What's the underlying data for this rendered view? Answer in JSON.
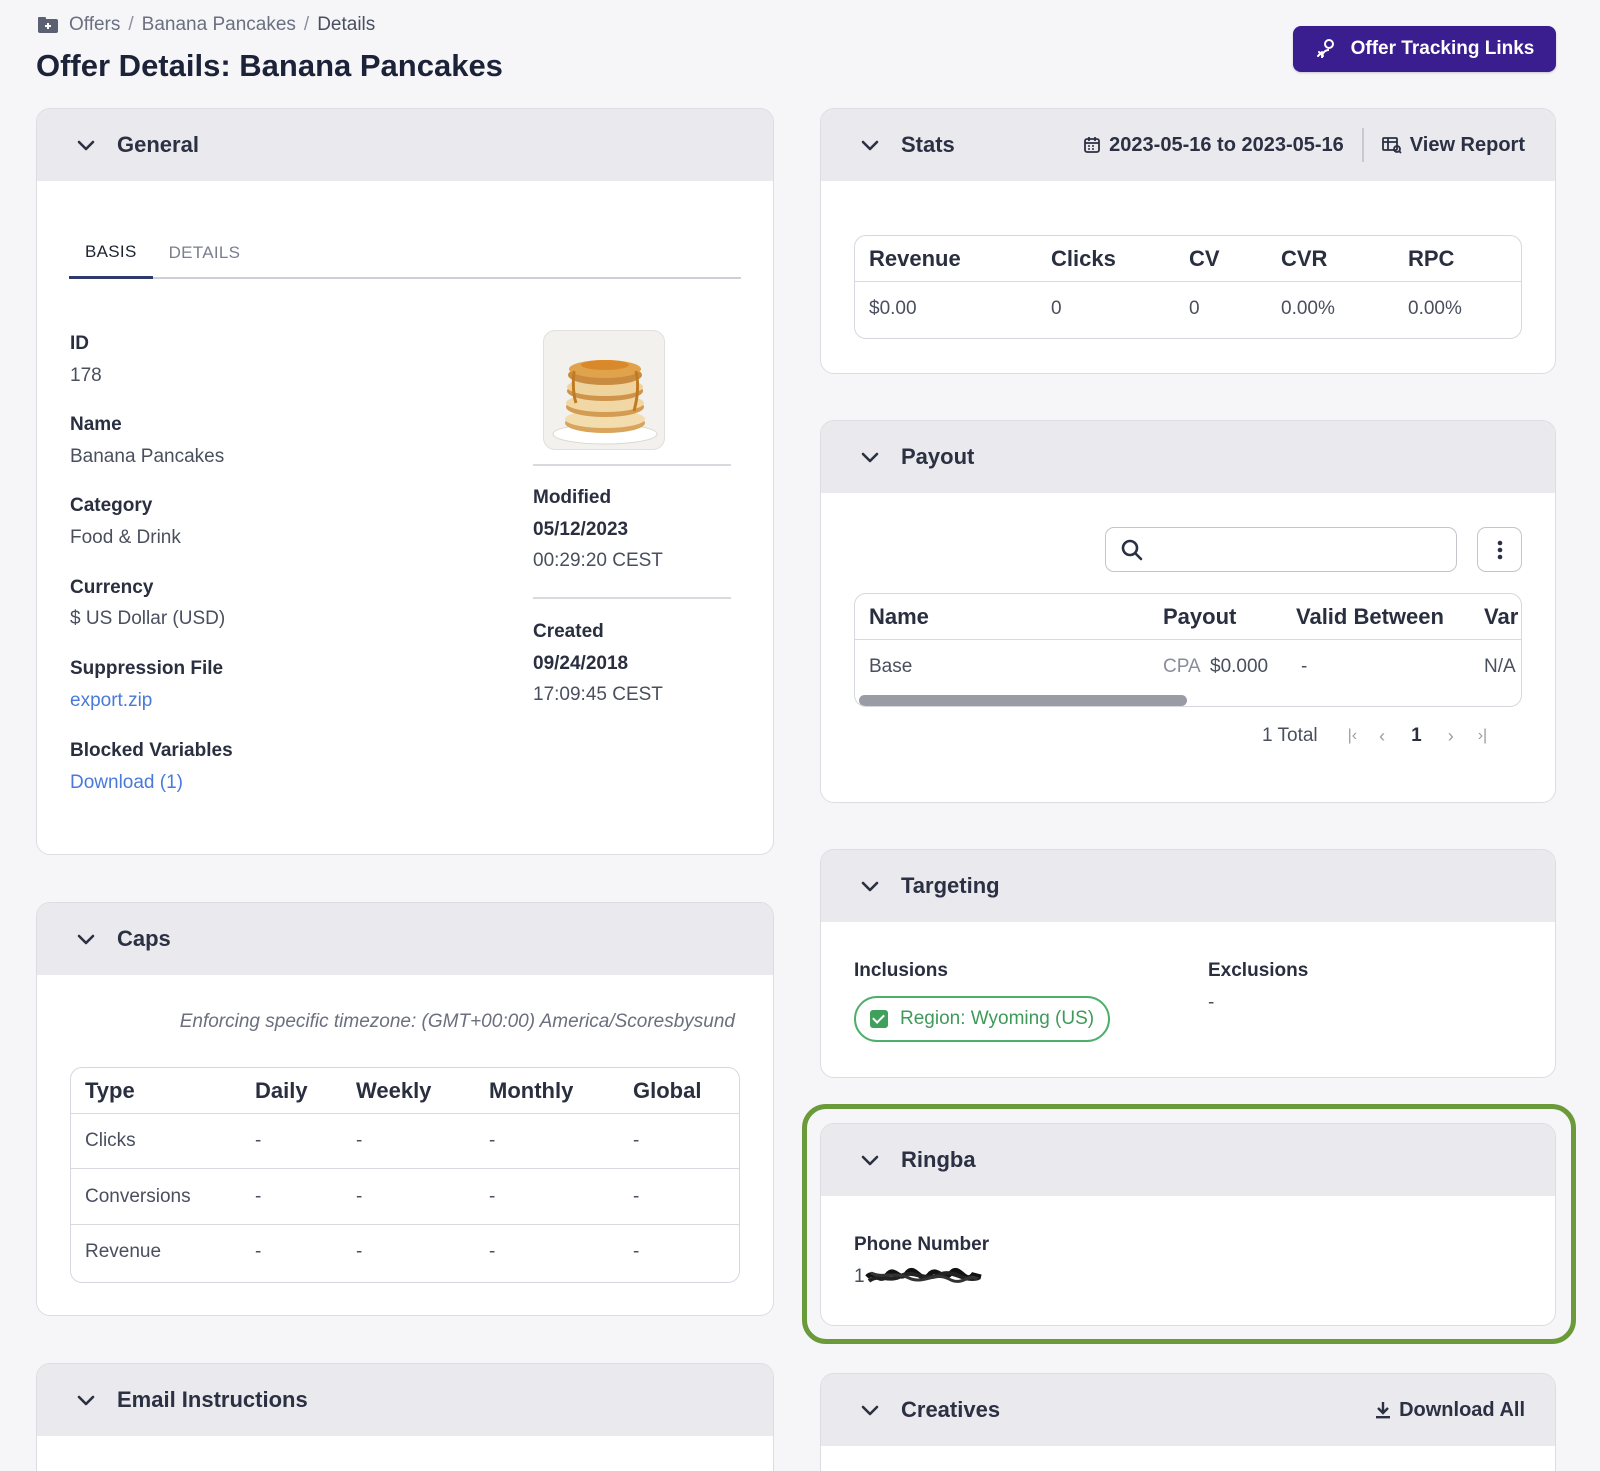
{
  "breadcrumb": {
    "root": "Offers",
    "middle": "Banana Pancakes",
    "current": "Details",
    "separator": "/"
  },
  "page_title": "Offer Details: Banana Pancakes",
  "header_button": {
    "label": "Offer Tracking Links"
  },
  "general": {
    "title": "General",
    "tabs": [
      {
        "label": "BASIS"
      },
      {
        "label": "DETAILS"
      }
    ],
    "fields": {
      "id_label": "ID",
      "id_value": "178",
      "name_label": "Name",
      "name_value": "Banana Pancakes",
      "category_label": "Category",
      "category_value": "Food & Drink",
      "currency_label": "Currency",
      "currency_value": "$ US Dollar (USD)",
      "suppression_label": "Suppression File",
      "suppression_value": "export.zip",
      "blocked_label": "Blocked Variables",
      "blocked_value": "Download (1)",
      "modified_label": "Modified",
      "modified_date": "05/12/2023",
      "modified_time": "00:29:20 CEST",
      "created_label": "Created",
      "created_date": "09/24/2018",
      "created_time": "17:09:45 CEST"
    }
  },
  "caps": {
    "title": "Caps",
    "timezone_note": "Enforcing specific timezone: (GMT+00:00) America/Scoresbysund",
    "headers": [
      "Type",
      "Daily",
      "Weekly",
      "Monthly",
      "Global"
    ],
    "rows": [
      [
        "Clicks",
        "-",
        "-",
        "-",
        "-"
      ],
      [
        "Conversions",
        "-",
        "-",
        "-",
        "-"
      ],
      [
        "Revenue",
        "-",
        "-",
        "-",
        "-"
      ]
    ]
  },
  "email_instructions": {
    "title": "Email Instructions"
  },
  "stats": {
    "title": "Stats",
    "date_range": "2023-05-16 to 2023-05-16",
    "view_report": "View Report",
    "headers": [
      "Revenue",
      "Clicks",
      "CV",
      "CVR",
      "RPC"
    ],
    "values": [
      "$0.00",
      "0",
      "0",
      "0.00%",
      "0.00%"
    ]
  },
  "payout": {
    "title": "Payout",
    "search_placeholder": "",
    "headers": [
      "Name",
      "Payout",
      "Valid Between",
      "Var"
    ],
    "row": {
      "name": "Base",
      "type": "CPA",
      "amount": "$0.000",
      "valid": "-",
      "var": "N/A"
    },
    "total": "1 Total",
    "page": "1"
  },
  "targeting": {
    "title": "Targeting",
    "inclusions_label": "Inclusions",
    "inclusion_pill": "Region: Wyoming (US)",
    "exclusions_label": "Exclusions",
    "exclusions_value": "-"
  },
  "ringba": {
    "title": "Ringba",
    "phone_label": "Phone Number",
    "phone_prefix": "1"
  },
  "creatives": {
    "title": "Creatives",
    "download_all": "Download All"
  },
  "colors": {
    "primary": "#3a1d8f",
    "link": "#4a7ad8",
    "success": "#3f9a5a",
    "highlight": "#6b9a3a"
  }
}
